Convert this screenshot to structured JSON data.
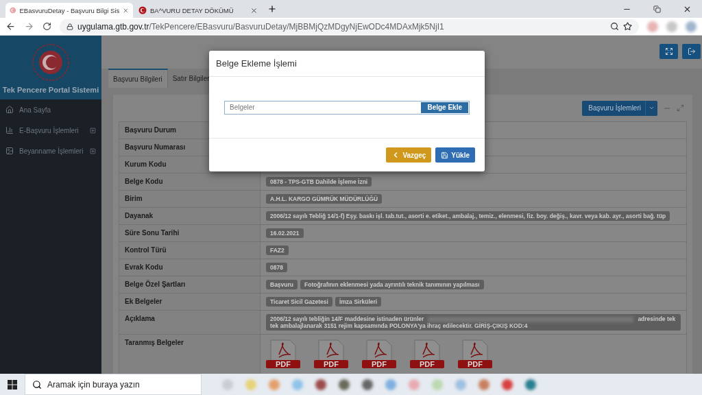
{
  "browser": {
    "tabs": [
      {
        "title": "EBasvuruDetay - Başvuru Bilgi Sis",
        "selected": true
      },
      {
        "title": "BA^VURU DETAY DÖKÜMÜ",
        "selected": false
      }
    ],
    "url_host": "uygulama.gtb.gov.tr",
    "url_path": "/TekPencere/EBasvuru/BasvuruDetay/MjBBMjQzMDgyNjEwODc4MDAxMjk5NjI1"
  },
  "sidebar": {
    "title": "Tek Pencere Portal Sistemi",
    "items": [
      {
        "label": "Ana Sayfa",
        "kind": "home",
        "expandable": false
      },
      {
        "label": "E-Başvuru İşlemleri",
        "kind": "chart",
        "expandable": true
      },
      {
        "label": "Beyanname İşlemleri",
        "kind": "image",
        "expandable": true
      }
    ]
  },
  "content": {
    "tabs": [
      {
        "label": "Başvuru Bilgileri",
        "selected": true
      },
      {
        "label": "Satır Bilgiler",
        "selected": false
      }
    ],
    "action_button": "Başvuru İşlemleri",
    "rows": [
      {
        "label": "Başvuru Durum",
        "kind": "badges"
      },
      {
        "label": "Başvuru Numarası",
        "kind": "badges"
      },
      {
        "label": "Kurum Kodu",
        "kind": "badges"
      },
      {
        "label": "Belge Kodu",
        "kind": "badges",
        "values": [
          "0878 - TPS-GTB Dahilde İşleme İzni"
        ]
      },
      {
        "label": "Birim",
        "kind": "badges",
        "values": [
          "A.H.L. KARGO GÜMRÜK MÜDÜRLÜĞÜ"
        ]
      },
      {
        "label": "Dayanak",
        "kind": "badges",
        "values": [
          "2006/12 sayılı Tebliğ 14/1-f) Eşy. baskı işl. tab.tut., asorti e. etiket., ambalaj., temiz., elenmesi, fiz. boy. değiş., kavr. veya kab. ayr., asorti bağ. tüp"
        ]
      },
      {
        "label": "Süre Sonu Tarihi",
        "kind": "badges",
        "values": [
          "16.02.2021"
        ]
      },
      {
        "label": "Kontrol Türü",
        "kind": "badges",
        "values": [
          "FAZ2"
        ]
      },
      {
        "label": "Evrak Kodu",
        "kind": "badges",
        "values": [
          "0878"
        ]
      },
      {
        "label": "Belge Özel Şartları",
        "kind": "badges",
        "values": [
          "Başvuru",
          "Fotoğrafının eklenmesi yada ayrıntılı teknik tanımının yapılması"
        ]
      },
      {
        "label": "Ek Belgeler",
        "kind": "badges",
        "values": [
          "Ticaret Sicil Gazetesi",
          "İmza Sirküleri"
        ]
      },
      {
        "label": "Açıklama",
        "kind": "note",
        "values": [
          "2006/12 sayılı tebliğin 14/F maddesine istinaden ürünler",
          "adresinde tek tek ambalajlanarak 3151 rejim kapsamında POLONYA'ya ihraç edilecektir. GİRİŞ-ÇIKIŞ KOD:4"
        ]
      },
      {
        "label": "Taranmış Belgeler",
        "kind": "files",
        "values": [
          "PDF",
          "PDF",
          "PDF",
          "PDF",
          "PDF"
        ]
      }
    ]
  },
  "modal": {
    "title": "Belge Ekleme İşlemi",
    "placeholder": "Belgeler",
    "add_button": "Belge Ekle",
    "buttons": [
      {
        "label": "Vazgeç",
        "kind": "cancel"
      },
      {
        "label": "Yükle",
        "kind": "upload"
      }
    ]
  },
  "taskbar": {
    "search_placeholder": "Aramak için buraya yazın"
  }
}
